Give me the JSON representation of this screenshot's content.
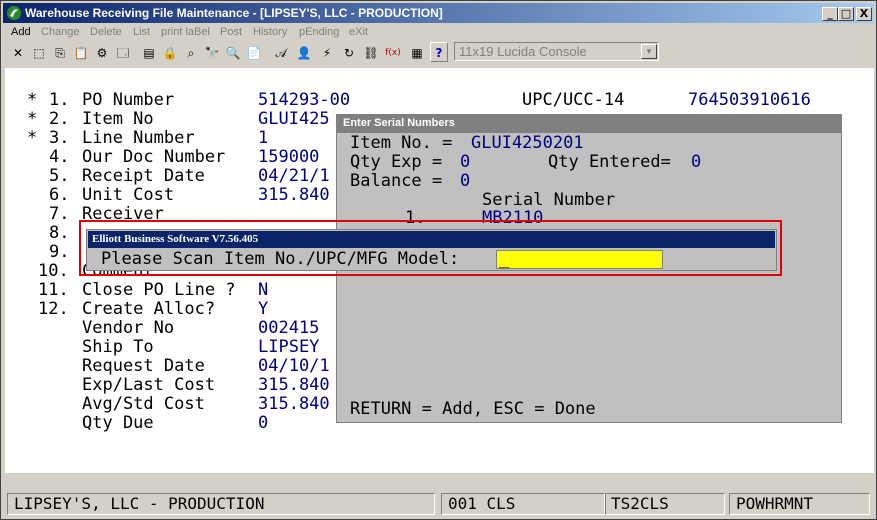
{
  "window": {
    "title": "Warehouse Receiving File Maintenance - [LIPSEY'S, LLC - PRODUCTION]",
    "minimize": "_",
    "maximize": "□",
    "close": "X"
  },
  "menu": [
    {
      "label": "Add",
      "enabled": true
    },
    {
      "label": "Change",
      "enabled": false
    },
    {
      "label": "Delete",
      "enabled": false
    },
    {
      "label": "List",
      "enabled": false
    },
    {
      "label": "print laBel",
      "enabled": false
    },
    {
      "label": "Post",
      "enabled": false
    },
    {
      "label": "History",
      "enabled": false
    },
    {
      "label": "pEnding",
      "enabled": false
    },
    {
      "label": "eXit",
      "enabled": false
    }
  ],
  "toolbar": {
    "icons": [
      "close-x-icon",
      "select-icon",
      "copy-icon",
      "paste-icon",
      "settings-icon",
      "window-icon",
      "note-icon",
      "lock-icon",
      "find-icon",
      "binoculars-icon",
      "zoom-icon",
      "document-icon",
      "font-icon",
      "person-icon",
      "lightning-icon",
      "refresh-icon",
      "link-icon",
      "function-icon",
      "calculator-icon",
      "book-icon",
      "help-icon"
    ],
    "icon_glyphs": [
      "✕",
      "⬚",
      "⎘",
      "📋",
      "⚙",
      "🗔",
      "▤",
      "🔒",
      "⌕",
      "🔭",
      "🔍",
      "📄",
      "𝒜",
      "👤",
      "⚡",
      "↻",
      "⛓",
      "f(x)",
      "▦",
      "📘",
      "?"
    ],
    "font_select": "11x19 Lucida Console"
  },
  "form": {
    "rows": [
      {
        "star": "*",
        "num": "1.",
        "label": "PO Number",
        "value": "514293-00"
      },
      {
        "star": "*",
        "num": "2.",
        "label": "Item No",
        "value": "GLUI425"
      },
      {
        "star": "*",
        "num": "3.",
        "label": "Line Number",
        "value": "1"
      },
      {
        "star": "",
        "num": "4.",
        "label": "Our Doc Number",
        "value": "159000"
      },
      {
        "star": "",
        "num": "5.",
        "label": "Receipt Date",
        "value": "04/21/1"
      },
      {
        "star": "",
        "num": "6.",
        "label": "Unit Cost",
        "value": "315.840"
      },
      {
        "star": "",
        "num": "7.",
        "label": "Receiver",
        "value": ""
      },
      {
        "star": "",
        "num": "8.",
        "label": "",
        "value": ""
      },
      {
        "star": "",
        "num": "9.",
        "label": "",
        "value": ""
      },
      {
        "star": "",
        "num": "10.",
        "label": "Comment",
        "value": ""
      },
      {
        "star": "",
        "num": "11.",
        "label": "Close PO Line ?",
        "value": "N"
      },
      {
        "star": "",
        "num": "12.",
        "label": "Create Alloc?",
        "value": "Y"
      },
      {
        "star": "",
        "num": "",
        "label": "Vendor No",
        "value": "002415"
      },
      {
        "star": "",
        "num": "",
        "label": "Ship To",
        "value": "LIPSEY"
      },
      {
        "star": "",
        "num": "",
        "label": "Request Date",
        "value": "04/10/1"
      },
      {
        "star": "",
        "num": "",
        "label": "Exp/Last Cost",
        "value": "315.840"
      },
      {
        "star": "",
        "num": "",
        "label": "Avg/Std Cost",
        "value": "315.840"
      },
      {
        "star": "",
        "num": "",
        "label": "Qty Due",
        "value": "0"
      }
    ],
    "upc_label": "UPC/UCC-14",
    "upc_value": "764503910616"
  },
  "serial_dialog": {
    "title": "Enter Serial Numbers",
    "item_label": "Item No. = ",
    "item_value": "GLUI4250201",
    "qty_exp_label": "Qty Exp = ",
    "qty_exp_value": "0",
    "qty_entered_label": "Qty Entered= ",
    "qty_entered_value": "0",
    "balance_label": "Balance = ",
    "balance_value": "0",
    "serial_header": "Serial Number",
    "serial_index": "1.",
    "serial_value": "MB2110",
    "footer": "RETURN = Add, ESC = Done"
  },
  "scan_dialog": {
    "title": "Elliott Business Software V7.56.405",
    "prompt": "Please Scan Item No./UPC/MFG Model:",
    "input_value": "_"
  },
  "status": {
    "company": "LIPSEY'S, LLC - PRODUCTION",
    "code": "001 CLS",
    "terminal": "TS2CLS",
    "program": "POWHRMNT"
  },
  "colors": {
    "title_bar_start": "#0a246a",
    "value_text": "#00007f",
    "highlight_border": "#e00000",
    "input_background": "#ffff00"
  }
}
